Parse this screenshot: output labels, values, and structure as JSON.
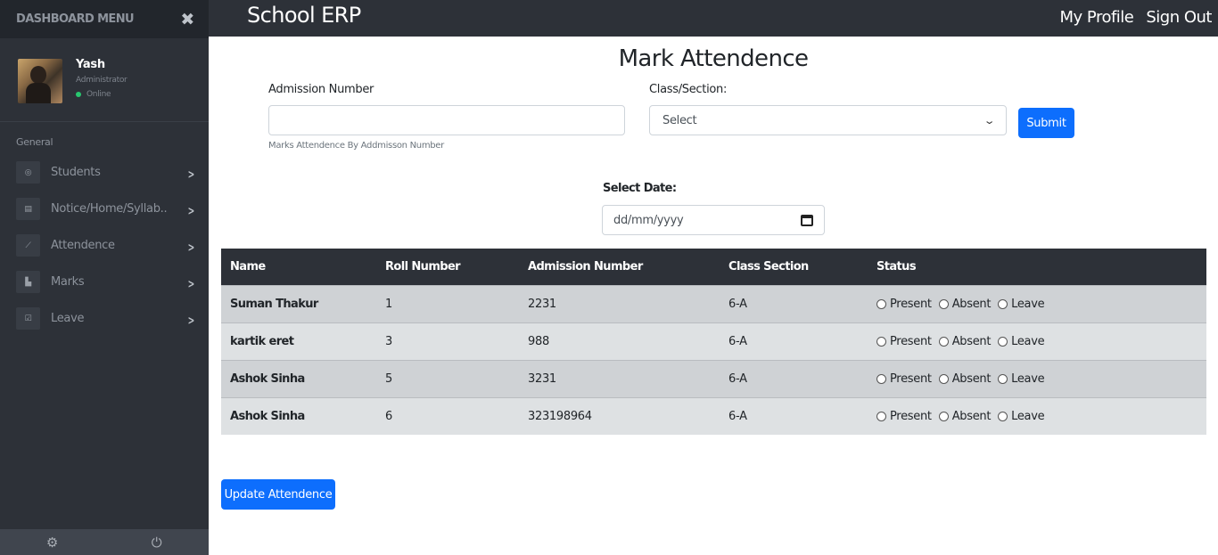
{
  "sidebar": {
    "brand": "DASHBOARD MENU",
    "profile": {
      "name": "Yash",
      "role": "Administrator",
      "status": "Online"
    },
    "section": "General",
    "items": [
      {
        "label": "Students",
        "icon": "user-circle-icon"
      },
      {
        "label": "Notice/Home/Syllab..",
        "icon": "document-icon"
      },
      {
        "label": "Attendence",
        "icon": "line-chart-icon"
      },
      {
        "label": "Marks",
        "icon": "area-chart-icon"
      },
      {
        "label": "Leave",
        "icon": "check-square-icon"
      }
    ],
    "footer": {
      "settings_icon": "gear-icon",
      "power_icon": "power-icon"
    }
  },
  "topbar": {
    "title": "School ERP",
    "nav": [
      "My Profile",
      "Sign Out"
    ]
  },
  "main": {
    "title": "Mark Attendence",
    "admission_label": "Admission Number",
    "admission_value": "",
    "admission_help": "Marks Attendence By Addmisson Number",
    "class_label": "Class/Section:",
    "class_selected": "Select",
    "submit_label": "Submit",
    "date_label": "Select Date:",
    "date_placeholder": "dd/mm/yyyy",
    "update_label": "Update Attendence"
  },
  "table": {
    "headers": [
      "Name",
      "Roll Number",
      "Admission Number",
      "Class Section",
      "Status"
    ],
    "status_options": [
      "Present",
      "Absent",
      "Leave"
    ],
    "rows": [
      {
        "name": "Suman Thakur",
        "roll": "1",
        "admission": "2231",
        "class": "6-A"
      },
      {
        "name": "kartik eret",
        "roll": "3",
        "admission": "988",
        "class": "6-A"
      },
      {
        "name": "Ashok Sinha",
        "roll": "5",
        "admission": "3231",
        "class": "6-A"
      },
      {
        "name": "Ashok Sinha",
        "roll": "6",
        "admission": "323198964",
        "class": "6-A"
      }
    ]
  },
  "colors": {
    "primary": "#0d6efd",
    "dark": "#2d3138",
    "online": "#28c76f"
  }
}
